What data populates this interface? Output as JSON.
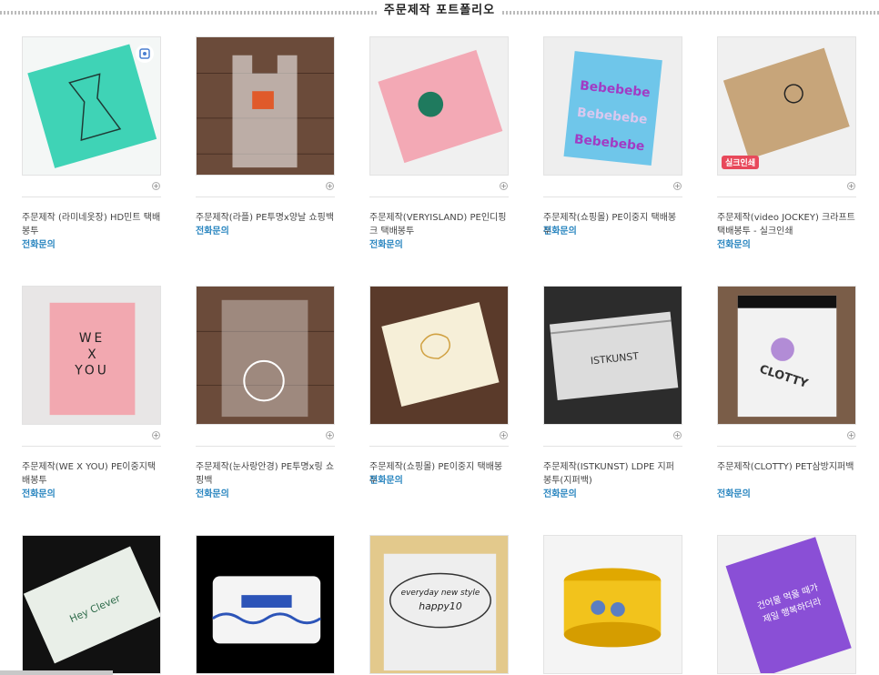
{
  "section_title": "주문제작 포트폴리오",
  "call_label": "전화문의",
  "items": [
    {
      "name": "주문제작 (라미네옷장) HD민트 택배봉투",
      "image": "mint-dress-mailer",
      "bg": "#8a9a8f",
      "color": "#3fd3b6"
    },
    {
      "name": "주문제작(라플) PE투명x양날 쇼핑백",
      "image": "clear-tshirt-bag",
      "bg": "#6b4b3a",
      "color": "#ffffff"
    },
    {
      "name": "주문제작(VERYISLAND) PE인디핑크 택배봉투",
      "image": "pink-bear-mailer",
      "bg": "#f0f0f0",
      "color": "#f3a9b5"
    },
    {
      "name": "주문제작(쇼핑몰) PE이중지 택배봉투",
      "image": "blue-bebebe-mailer",
      "bg": "#eeeeee",
      "color": "#6fc6ea"
    },
    {
      "name": "주문제작(video JOCKEY) 크라프트 택배봉투 - 실크인쇄",
      "image": "kraft-mailer",
      "bg": "#f0f0f0",
      "color": "#c7a57a",
      "badge": "실크인쇄"
    },
    {
      "name": "주문제작(WE X YOU) PE이중지택배봉투",
      "image": "pink-wexyou-mailer",
      "bg": "#e8e6e6",
      "color": "#f2a8b0"
    },
    {
      "name": "주문제작(눈사랑안경) PE투명x링 쇼핑백",
      "image": "clear-ring-bag",
      "bg": "#6b4b3a",
      "color": "#ffffff"
    },
    {
      "name": "주문제작(쇼핑몰) PE이중지 택배봉투",
      "image": "ivory-mailer",
      "bg": "#5a3a2a",
      "color": "#f6efd8"
    },
    {
      "name": "주문제작(ISTKUNST) LDPE 지퍼봉투(지퍼백)",
      "image": "clear-zipper-bag",
      "bg": "#2c2c2c",
      "color": "#dcdcdc"
    },
    {
      "name": "주문제작(CLOTTY) PET삼방지퍼백",
      "image": "clotty-zipper-bag",
      "bg": "#7a5d48",
      "color": "#dddddd"
    },
    {
      "name": "",
      "image": "white-heyclever-mailer",
      "bg": "#111111",
      "color": "#e9efe8"
    },
    {
      "name": "",
      "image": "blue-tape",
      "bg": "#000000",
      "color": "#ffffff"
    },
    {
      "name": "",
      "image": "white-everyday-mailer",
      "bg": "#e3c98c",
      "color": "#eeeeee"
    },
    {
      "name": "",
      "image": "yellow-minion-tape",
      "bg": "#f4f4f4",
      "color": "#f2c31c"
    },
    {
      "name": "",
      "image": "purple-mailer",
      "bg": "#f2f2f2",
      "color": "#8a4fd6"
    }
  ],
  "thumb_texts": {
    "bebebe": "Bebebebe",
    "wexyou": [
      "WE",
      "X",
      "YOU"
    ],
    "istkunst": "ISTKUNST",
    "clotty": "CLOTTY",
    "heyclever": "Hey Clever",
    "everyday": [
      "everyday new style",
      "happy10"
    ],
    "purple": [
      "건어물 먹을 때가",
      "제일 행복하더라"
    ]
  }
}
